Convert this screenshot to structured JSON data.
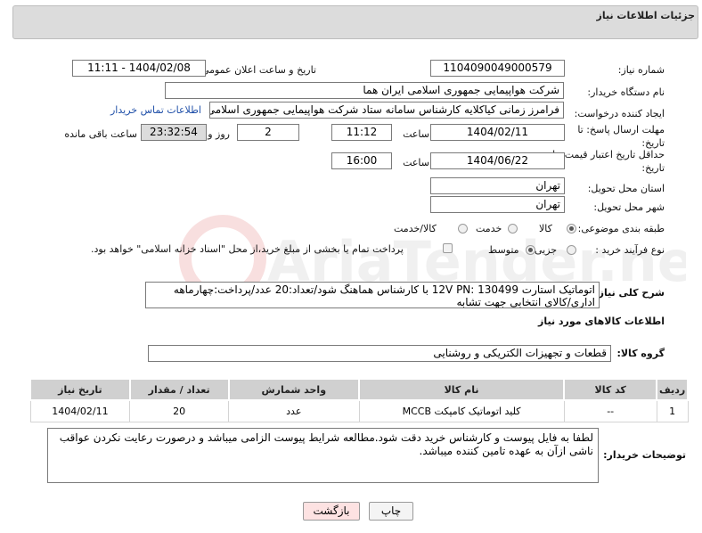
{
  "header": {
    "title": "جزئیات اطلاعات نیاز"
  },
  "form": {
    "need_number_label": "شماره نیاز:",
    "need_number": "1104090049000579",
    "announce_label": "تاریخ و ساعت اعلان عمومی:",
    "announce_value": "1404/02/08 - 11:11",
    "buyer_label": "نام دستگاه خریدار:",
    "buyer_value": "شرکت هواپیمایی جمهوری اسلامی ایران هما",
    "creator_label": "ایجاد کننده درخواست:",
    "creator_value": "فرامرز زمانی کیاکلایه کارشناس سامانه ستاد شرکت هواپیمایی جمهوری اسلامی",
    "contact_link": "اطلاعات تماس خریدار",
    "deadline_label": "مهلت ارسال پاسخ: تا تاریخ:",
    "deadline_date": "1404/02/11",
    "time_label": "ساعت",
    "deadline_time": "11:12",
    "days_value": "2",
    "days_label": "روز و",
    "remaining_time": "23:32:54",
    "remaining_label": "ساعت باقی مانده",
    "validity_label": "حداقل تاریخ اعتبار قیمت: تا تاریخ:",
    "validity_date": "1404/06/22",
    "validity_time_label": "ساعت",
    "validity_time": "16:00",
    "province_label": "استان محل تحویل:",
    "province_value": "تهران",
    "city_label": "شهر محل تحویل:",
    "city_value": "تهران",
    "category_label": "طبقه بندی موضوعی:",
    "category_options": [
      "کالا",
      "خدمت",
      "کالا/خدمت"
    ],
    "process_label": "نوع فرآیند خرید :",
    "process_options": [
      "جزیی",
      "متوسط"
    ],
    "payment_note": "پرداخت تمام یا بخشی از مبلغ خرید،از محل \"اسناد خزانه اسلامی\" خواهد بود.",
    "description_label": "شرح کلی نیاز:",
    "description_value": "اتوماتیک استارت  12V PN: 130499  با کارشناس هماهنگ شود/تعداد:20 عدد/پرداخت:چهارماهه اداری/کالای انتخابی جهت تشابه"
  },
  "goods": {
    "section_title": "اطلاعات کالاهای مورد نیاز",
    "group_label": "گروه کالا:",
    "group_value": "قطعات و تجهیزات الکتریکی و روشنایی",
    "columns": [
      "ردیف",
      "کد کالا",
      "نام کالا",
      "واحد شمارش",
      "تعداد / مقدار",
      "تاریخ نیاز"
    ],
    "rows": [
      {
        "row": "1",
        "code": "--",
        "name": "کلید اتوماتیک کامپکت MCCB",
        "unit": "عدد",
        "qty": "20",
        "date": "1404/02/11"
      }
    ]
  },
  "notes": {
    "label": "توضیحات خریدار:",
    "value": "لطفا به فایل پیوست و کارشناس خرید دقت شود.مطالعه شرایط پیوست الزامی میباشد و درصورت رعایت نکردن عواقب ناشی ازآن به عهده تامین کننده میباشد."
  },
  "buttons": {
    "print": "چاپ",
    "back": "بازگشت"
  },
  "colors": {
    "link": "#1f4fa8",
    "back_button_bg": "#fde2e2",
    "header_bg": "#dcdcdc",
    "table_header_bg": "#d0d0d0"
  }
}
